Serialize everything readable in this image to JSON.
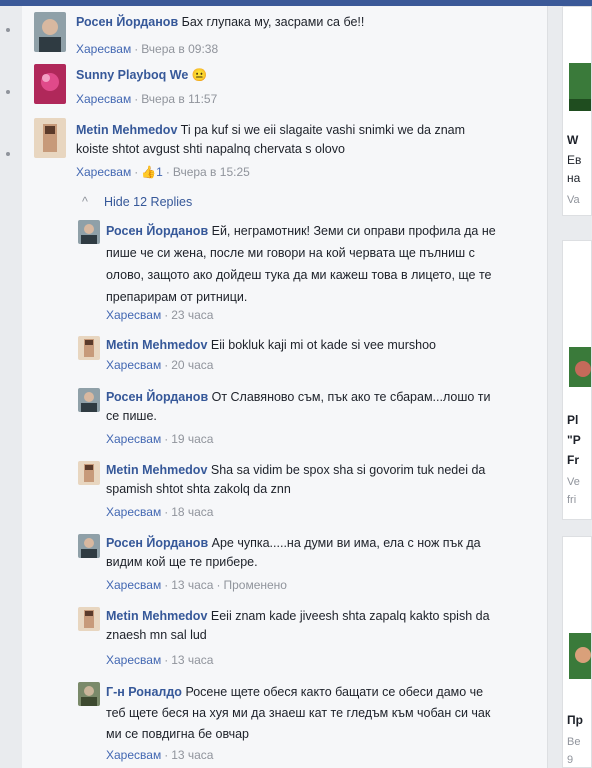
{
  "comments": [
    {
      "name": "Росен Йорданов",
      "text": "Бах глупака му, засрами са бе!!",
      "like_label": "Харесвам",
      "time": "Вчера в 09:38"
    },
    {
      "name": "Sunny Playboq We",
      "emoji": "😐",
      "text": "",
      "like_label": "Харесвам",
      "time": "Вчера в 11:57"
    },
    {
      "name": "Metin Mehmedov",
      "text": "Ti pa kuf si we eii slagaite vashi snimki we da znam koiste shtot avgust shti napalnq chervata s olovo",
      "like_label": "Харесвам",
      "like_count": "1",
      "time": "Вчера в 15:25"
    }
  ],
  "hide_replies_label": "Hide 12 Replies",
  "replies": [
    {
      "name": "Росен Йорданов",
      "text": "Ей, неграмотник! Земи си оправи профила да не пише че си жена, после ми говори на кой червата ще пълниш с олово, защото ако дойдеш тука да ми кажеш това в лицето, ще те препарирам от ритници.",
      "like_label": "Харесвам",
      "time": "23 часа"
    },
    {
      "name": "Metin Mehmedov",
      "text": "Eii bokluk kaji mi ot kade si vee murshoo",
      "like_label": "Харесвам",
      "time": "20 часа"
    },
    {
      "name": "Росен Йорданов",
      "text": "От Славяново съм, пък ако те сбарам...лошо ти се пише.",
      "like_label": "Харесвам",
      "time": "19 часа"
    },
    {
      "name": "Metin Mehmedov",
      "text": "Sha sa vidim be spox sha si govorim tuk nedei da spamish shtot shta zakolq da znn",
      "like_label": "Харесвам",
      "time": "18 часа"
    },
    {
      "name": "Росен Йорданов",
      "text": "Аре чупка.....на думи ви има, ела с нож пък да видим кой ще те прибере.",
      "like_label": "Харесвам",
      "time": "13 часа",
      "edited": "Променено"
    },
    {
      "name": "Metin Mehmedov",
      "text": "Eeii znam kade jiveesh shta zapalq kakto spish da znaesh mn sal lud",
      "like_label": "Харесвам",
      "time": "13 часа"
    },
    {
      "name": "Г-н Роналдо",
      "text": "Росене щете обеся както бащати се обеси дамо че теб щете беся на хуя ми да знаеш кат те гледъм към чобан си чак ми се повдигна бе овчар",
      "like_label": "Харесвам",
      "time": "13 часа"
    }
  ],
  "sidebar_cards": [
    {
      "lines": [
        "W",
        "Ев",
        "на",
        "Va"
      ]
    },
    {
      "lines": [
        "Pl",
        "\"P",
        "Fr",
        "Ve",
        "fri"
      ]
    },
    {
      "lines": [
        "Пр",
        "Ве",
        "9"
      ]
    }
  ],
  "colors": {
    "link": "#365899",
    "meta": "#90949c",
    "like": "#4267b2",
    "panel": "#f6f7f9",
    "page": "#e9ebee",
    "brand": "#3b5998"
  }
}
